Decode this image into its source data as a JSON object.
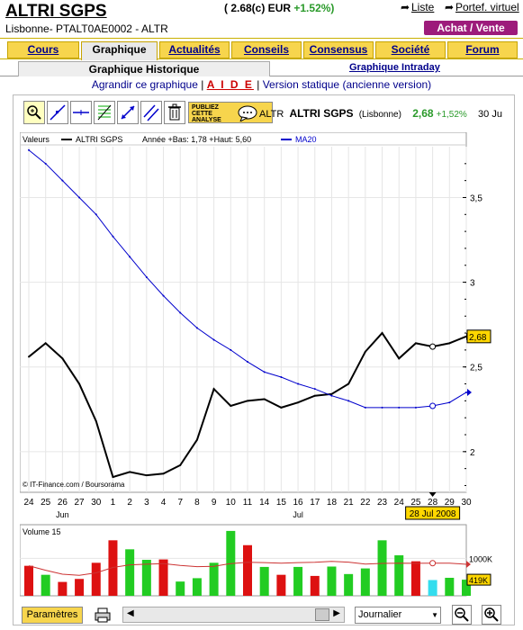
{
  "header": {
    "title": "ALTRI SGPS",
    "price": "( 2.68(c) EUR",
    "change": "+1.52%)",
    "isin": "Lisbonne- PTALT0AE0002 - ALTR",
    "liste_label": "Liste",
    "portef_label": "Portef. virtuel",
    "achat_label": "Achat / Vente"
  },
  "tabs": [
    "Cours",
    "Graphique",
    "Actualités",
    "Conseils",
    "Consensus",
    "Société",
    "Forum"
  ],
  "subtabs": {
    "historique": "Graphique Historique",
    "intraday": "Graphique Intraday"
  },
  "links": {
    "agrandir": "Agrandir ce graphique",
    "sep1": " | ",
    "aide": "A I D E",
    "sep2": " | ",
    "version": "Version statique ",
    "ancienne": "(ancienne version)"
  },
  "toolbar": {
    "publiez": "PUBLIEZ",
    "cette": "CETTE",
    "analyse": "ANALYSE",
    "code": "ALTR",
    "name": "ALTRI SGPS",
    "market": "(Lisbonne)",
    "price": "2,68",
    "pct": "+1,52%",
    "date": "30 Ju"
  },
  "icons": [
    "zoom-icon",
    "line-icon",
    "hline-icon",
    "fibonacci-icon",
    "arrows-icon",
    "parallel-icon",
    "trash-icon",
    "speech-bubble-icon",
    "printer-icon",
    "zoom-out-icon",
    "zoom-in-icon"
  ],
  "chart_data": {
    "type": "line",
    "legend": {
      "valeurs": "Valeurs",
      "series1": "ALTRI SGPS",
      "stats": "Année +Bas: 1,78 +Haut: 5,60",
      "series2": "MA20"
    },
    "x_ticks": [
      "24",
      "25",
      "26",
      "27",
      "30",
      "1",
      "2",
      "3",
      "4",
      "7",
      "8",
      "9",
      "10",
      "11",
      "14",
      "15",
      "16",
      "17",
      "18",
      "21",
      "22",
      "23",
      "24",
      "25",
      "28",
      "29",
      "30"
    ],
    "month_labels": [
      "Jun",
      "Jul"
    ],
    "y_ticks": [
      "3,5",
      "3",
      "2,5",
      "2"
    ],
    "ylim": [
      1.76,
      3.8
    ],
    "series": [
      {
        "name": "ALTRI SGPS",
        "color": "#000000",
        "values": [
          2.56,
          2.64,
          2.55,
          2.4,
          2.18,
          1.85,
          1.88,
          1.86,
          1.87,
          1.92,
          2.07,
          2.37,
          2.27,
          2.3,
          2.31,
          2.26,
          2.29,
          2.33,
          2.34,
          2.4,
          2.59,
          2.7,
          2.55,
          2.64,
          2.62,
          2.64,
          2.68
        ]
      },
      {
        "name": "MA20",
        "color": "#0000cc",
        "values": [
          3.78,
          3.7,
          3.6,
          3.5,
          3.4,
          3.27,
          3.15,
          3.03,
          2.92,
          2.82,
          2.73,
          2.66,
          2.6,
          2.53,
          2.47,
          2.44,
          2.4,
          2.37,
          2.33,
          2.3,
          2.26,
          2.26,
          2.26,
          2.26,
          2.27,
          2.29,
          2.35
        ]
      }
    ],
    "last_label": "2,68",
    "cursor_date": "28 Jul 2008",
    "watermark": "© IT-Finance.com / Boursorama",
    "volume": {
      "title": "Volume 15",
      "ticks": [
        "1000K"
      ],
      "last_label": "419K",
      "values": [
        800,
        560,
        370,
        450,
        880,
        1480,
        1240,
        960,
        970,
        380,
        470,
        880,
        1730,
        1350,
        770,
        560,
        770,
        530,
        780,
        580,
        730,
        1480,
        1080,
        920,
        420,
        480,
        430
      ],
      "colors": [
        "red",
        "green",
        "red",
        "red",
        "red",
        "red",
        "green",
        "green",
        "red",
        "green",
        "green",
        "green",
        "green",
        "red",
        "green",
        "red",
        "green",
        "red",
        "green",
        "green",
        "green",
        "green",
        "green",
        "red",
        "cyan",
        "green",
        "green"
      ]
    }
  },
  "bottom": {
    "params": "Paramètres",
    "period": "Journalier"
  },
  "colors": {
    "accent": "#f7d54d",
    "brand": "#9d1b7b",
    "up": "#22cc22",
    "down": "#cc1111"
  }
}
